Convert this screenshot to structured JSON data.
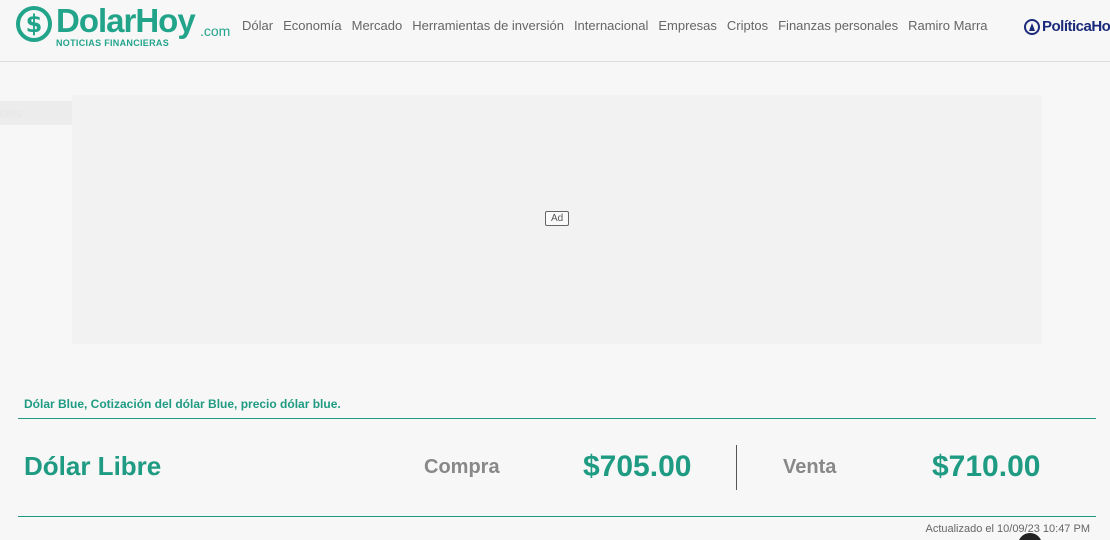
{
  "header": {
    "logo_symbol": "$",
    "logo_word": "DolarHoy",
    "logo_suffix": ".com",
    "logo_tagline": "NOTICIAS FINANCIERAS",
    "nav": [
      "Dólar",
      "Economía",
      "Mercado",
      "Herramientas de inversión",
      "Internacional",
      "Empresas",
      "Criptos",
      "Finanzas personales",
      "Ramiro Marra"
    ],
    "partner_label": "PolíticaHo"
  },
  "side_tab_label": "oles",
  "ad": {
    "badge": "Ad"
  },
  "quote": {
    "section_title": "Dólar Blue, Cotización del dólar Blue, precio dólar blue.",
    "name": "Dólar Libre",
    "compra_label": "Compra",
    "compra_value": "$705.00",
    "venta_label": "Venta",
    "venta_value": "$710.00",
    "updated": "Actualizado el 10/09/23 10:47 PM"
  },
  "colors": {
    "brand": "#22a48b",
    "partner": "#1b2a7a",
    "background": "#f7f7f7"
  }
}
